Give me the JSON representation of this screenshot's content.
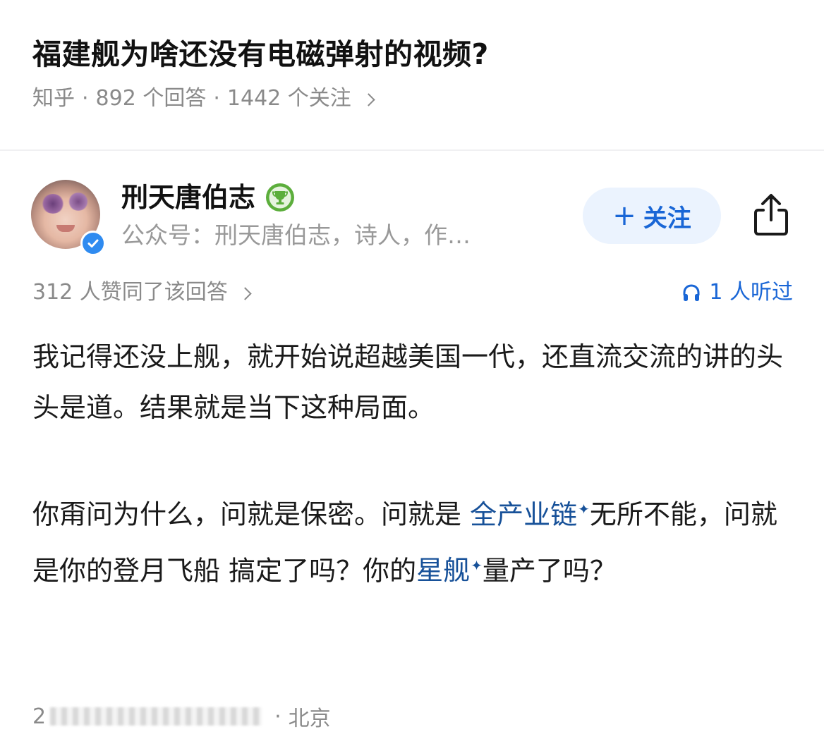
{
  "question": {
    "title": "福建舰为啥还没有电磁弹射的视频?",
    "source": "知乎",
    "answer_count": "892 个回答",
    "follow_count": "1442 个关注"
  },
  "author": {
    "name": "刑天唐伯志",
    "bio": "公众号：刑天唐伯志，诗人，作…",
    "follow_label": "关注",
    "follow_plus": "+"
  },
  "stats": {
    "upvotes": "312 人赞同了该回答",
    "listened": "1 人听过"
  },
  "answer": {
    "p1": "我记得还没上舰，就开始说超越美国一代，还直流交流的讲的头头是道。结果就是当下这种局面。",
    "p2_part1": "你甭问为什么，问就是保密。问就是 ",
    "p2_link1": "全产业链",
    "p2_part2": "无所不能，问就是你的登月飞船 搞定了吗？你的",
    "p2_link2": "星舰",
    "p2_part3": "量产了吗？",
    "sparkle": "✦"
  },
  "footer": {
    "date_prefix": "2",
    "location": "北京",
    "separator": "·"
  },
  "colors": {
    "accent": "#1966d6",
    "link": "#175199",
    "follow_bg": "#ebf3fe",
    "meta_gray": "#8a8a8a",
    "verified": "#2f8bf0",
    "trophy": "#5cae3c"
  }
}
